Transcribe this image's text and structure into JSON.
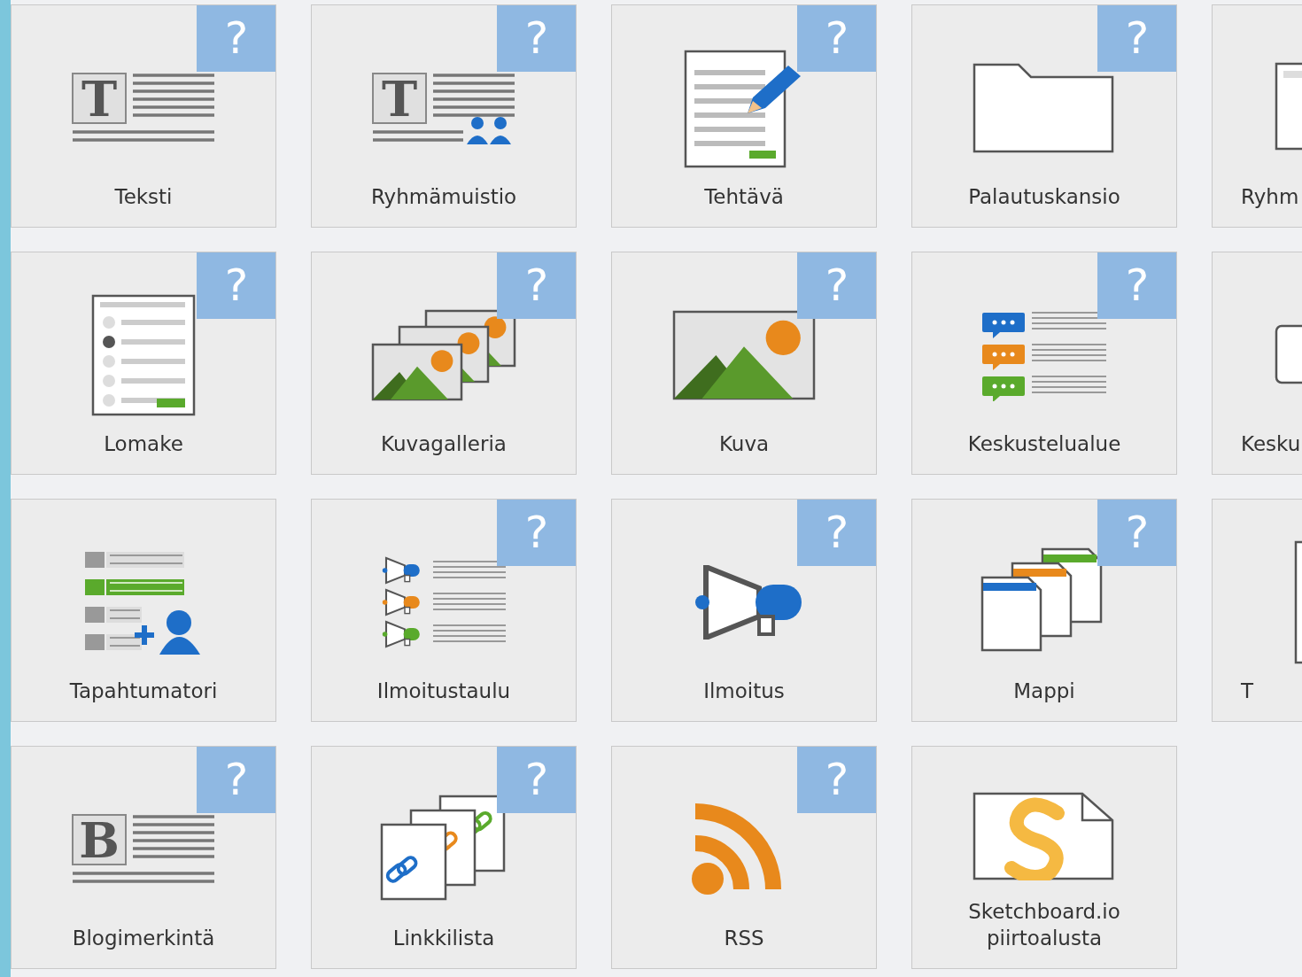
{
  "tiles": [
    {
      "kind": "text",
      "label": "Teksti",
      "letter": "T",
      "help": "?"
    },
    {
      "kind": "group-memo",
      "label": "Ryhmämuistio",
      "letter": "T",
      "help": "?"
    },
    {
      "kind": "assignment",
      "label": "Tehtävä",
      "help": "?"
    },
    {
      "kind": "folder",
      "label": "Palautuskansio",
      "help": "?"
    },
    {
      "kind": "edge-page",
      "label": "Ryhm"
    },
    {
      "kind": "form",
      "label": "Lomake",
      "help": "?"
    },
    {
      "kind": "gallery",
      "label": "Kuvagalleria",
      "help": "?"
    },
    {
      "kind": "image",
      "label": "Kuva",
      "help": "?"
    },
    {
      "kind": "forum",
      "label": "Keskustelualue",
      "help": "?"
    },
    {
      "kind": "edge-bubble",
      "label": "Kesku"
    },
    {
      "kind": "event",
      "label": "Tapahtumatori"
    },
    {
      "kind": "board",
      "label": "Ilmoitustaulu",
      "help": "?"
    },
    {
      "kind": "announcement",
      "label": "Ilmoitus",
      "help": "?"
    },
    {
      "kind": "binder",
      "label": "Mappi",
      "help": "?"
    },
    {
      "kind": "edge-doc",
      "label": "T"
    },
    {
      "kind": "blog",
      "label": "Blogimerkintä",
      "letter": "B",
      "help": "?"
    },
    {
      "kind": "links",
      "label": "Linkkilista",
      "help": "?"
    },
    {
      "kind": "rss",
      "label": "RSS",
      "help": "?"
    },
    {
      "kind": "sketch",
      "label": "Sketchboard.io piirtoalusta"
    }
  ]
}
